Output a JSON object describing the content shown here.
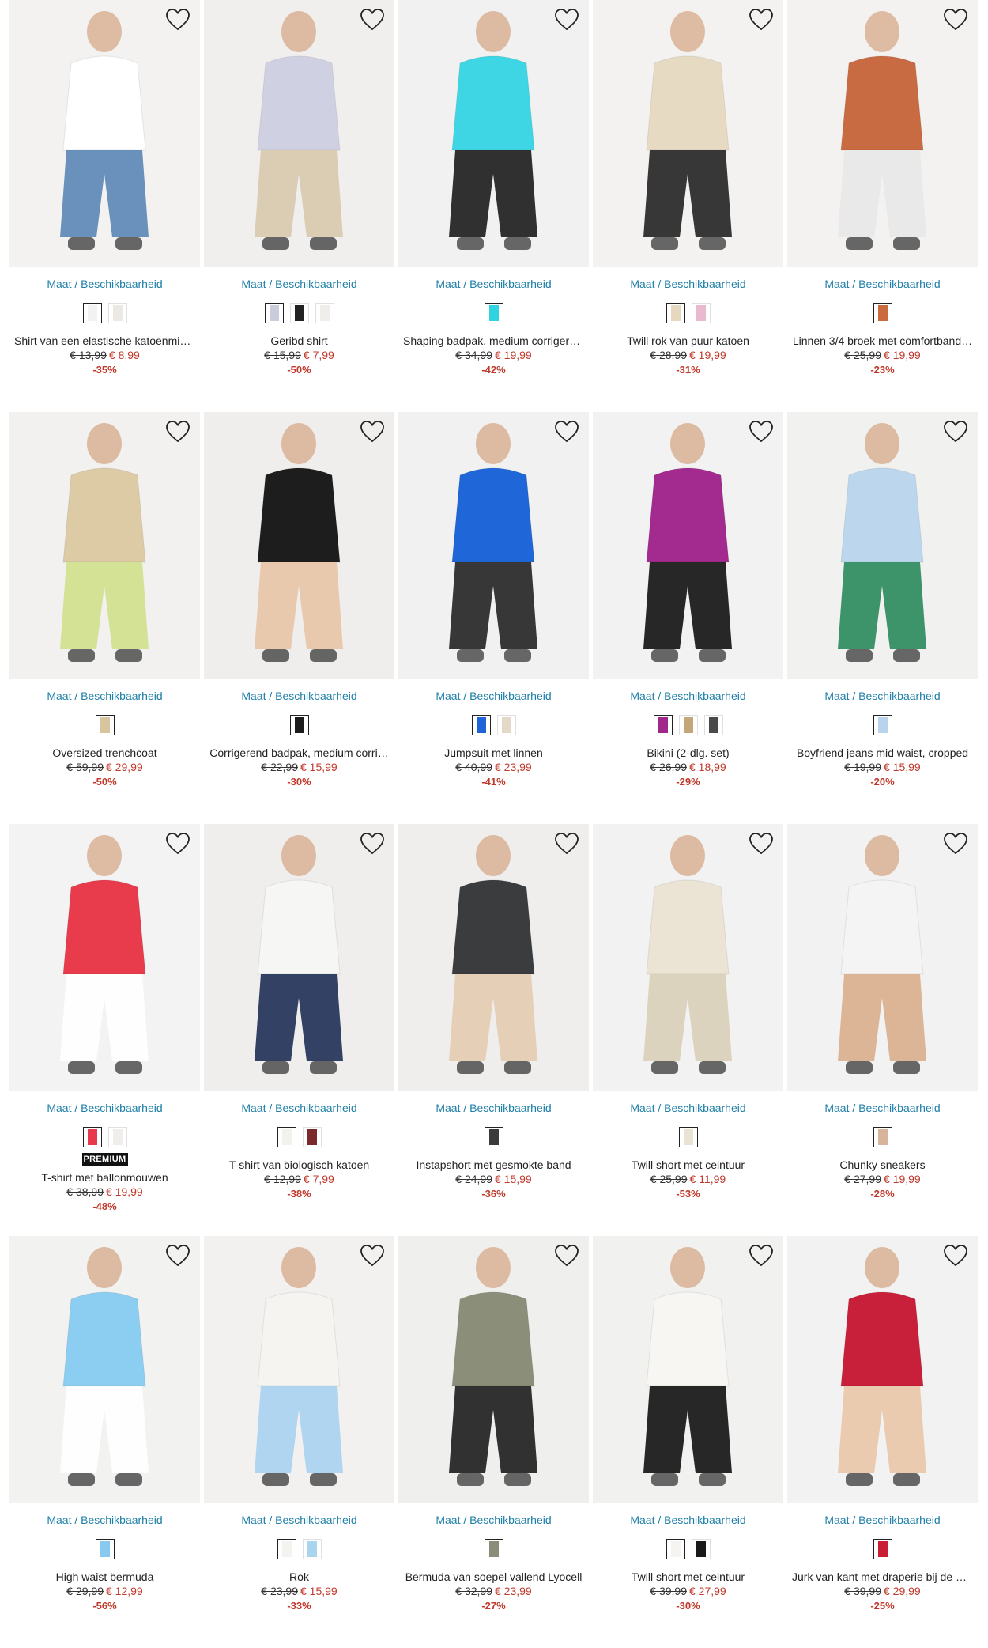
{
  "availability_label": "Maat / Beschikbaarheid",
  "premium_label": "PREMIUM",
  "products": [
    {
      "title": "Shirt van een elastische katoenmix …",
      "old": "€ 13,99",
      "new": "€ 8,99",
      "disc": "-35%",
      "swatches": [
        "#f2f2f2",
        "#ece9e4"
      ],
      "bg": "#f3f2f0",
      "garment": "#ffffff",
      "accent": "#5b86b5"
    },
    {
      "title": "Geribd shirt",
      "old": "€ 15,99",
      "new": "€ 7,99",
      "disc": "-50%",
      "swatches": [
        "#c9ccdb",
        "#222222",
        "#efeeea"
      ],
      "bg": "#f0efee",
      "garment": "#cfd1e2",
      "accent": "#d8c9ad"
    },
    {
      "title": "Shaping badpak, medium corrigerend",
      "old": "€ 34,99",
      "new": "€ 19,99",
      "disc": "-42%",
      "swatches": [
        "#2fd4e0"
      ],
      "bg": "#f1f1f1",
      "garment": "#3ed6e4",
      "accent": "#1b1b1b"
    },
    {
      "title": "Twill rok van puur katoen",
      "old": "€ 28,99",
      "new": "€ 19,99",
      "disc": "-31%",
      "swatches": [
        "#e5d8bf",
        "#e8b9cf"
      ],
      "bg": "#f3f2f0",
      "garment": "#e6dac3",
      "accent": "#222222"
    },
    {
      "title": "Linnen 3/4 broek met comfortband…",
      "old": "€ 25,99",
      "new": "€ 19,99",
      "disc": "-23%",
      "swatches": [
        "#c96a3f"
      ],
      "bg": "#f3f2f0",
      "garment": "#c96b42",
      "accent": "#e8e8e8"
    },
    {
      "title": "Oversized trenchcoat",
      "old": "€ 59,99",
      "new": "€ 29,99",
      "disc": "-50%",
      "swatches": [
        "#d8c49d"
      ],
      "bg": "#f2f1ef",
      "garment": "#dccba4",
      "accent": "#cfe08a"
    },
    {
      "title": "Corrigerend badpak, medium corri…",
      "old": "€ 22,99",
      "new": "€ 15,99",
      "disc": "-30%",
      "swatches": [
        "#1c1c1c"
      ],
      "bg": "#efeeec",
      "garment": "#1d1d1d",
      "accent": "#e8c4a6"
    },
    {
      "title": "Jumpsuit met linnen",
      "old": "€ 40,99",
      "new": "€ 23,99",
      "disc": "-41%",
      "swatches": [
        "#1f63d6",
        "#e3d9c6"
      ],
      "bg": "#f1f1f1",
      "garment": "#1f66d8",
      "accent": "#222222"
    },
    {
      "title": "Bikini (2-dlg. set)",
      "old": "€ 26,99",
      "new": "€ 18,99",
      "disc": "-29%",
      "swatches": [
        "#a0288a",
        "#c3a77a",
        "#4a4a4a"
      ],
      "bg": "#f2f2f2",
      "garment": "#a32a8f",
      "accent": "#111111"
    },
    {
      "title": "Boyfriend jeans mid waist, cropped",
      "old": "€ 19,99",
      "new": "€ 15,99",
      "disc": "-20%",
      "swatches": [
        "#b9d3ec"
      ],
      "bg": "#f1f1f0",
      "garment": "#bcd6ee",
      "accent": "#2a8a5b"
    },
    {
      "title": "T-shirt met ballonmouwen",
      "old": "€ 38,99",
      "new": "€ 19,99",
      "disc": "-48%",
      "swatches": [
        "#e8394a",
        "#f0eeea"
      ],
      "premium": true,
      "bg": "#f3f3f3",
      "garment": "#e83c4c",
      "accent": "#ffffff"
    },
    {
      "title": "T-shirt van biologisch katoen",
      "old": "€ 12,99",
      "new": "€ 7,99",
      "disc": "-38%",
      "swatches": [
        "#f3f1ec",
        "#7a2a2a"
      ],
      "bg": "#efeeed",
      "garment": "#f6f6f4",
      "accent": "#1e2d55"
    },
    {
      "title": "Instapshort met gesmokte band",
      "old": "€ 24,99",
      "new": "€ 15,99",
      "disc": "-36%",
      "swatches": [
        "#3a3a3a"
      ],
      "bg": "#efeeed",
      "garment": "#3b3c3d",
      "accent": "#e3ccb0"
    },
    {
      "title": "Twill short met ceintuur",
      "old": "€ 25,99",
      "new": "€ 11,99",
      "disc": "-53%",
      "swatches": [
        "#e9e3d3"
      ],
      "bg": "#f2f2f2",
      "garment": "#ebe4d4",
      "accent": "#d9cfb8"
    },
    {
      "title": "Chunky sneakers",
      "old": "€ 27,99",
      "new": "€ 19,99",
      "disc": "-28%",
      "swatches": [
        "#d8b59a"
      ],
      "bg": "#f2f2f2",
      "garment": "#f4f4f4",
      "accent": "#d9ae8c"
    },
    {
      "title": "High waist bermuda",
      "old": "€ 29,99",
      "new": "€ 12,99",
      "disc": "-56%",
      "swatches": [
        "#87c9f0"
      ],
      "bg": "#f2f2f1",
      "garment": "#8ccdf2",
      "accent": "#ffffff"
    },
    {
      "title": "Rok",
      "old": "€ 23,99",
      "new": "€ 15,99",
      "disc": "-33%",
      "swatches": [
        "#f4f3ef",
        "#a9d4ee"
      ],
      "bg": "#f2f1f0",
      "garment": "#f5f4f0",
      "accent": "#a8d2ef"
    },
    {
      "title": "Bermuda van soepel vallend Lyocell",
      "old": "€ 32,99",
      "new": "€ 23,99",
      "disc": "-27%",
      "swatches": [
        "#8a8e78"
      ],
      "bg": "#efefed",
      "garment": "#8b8f79",
      "accent": "#1c1c1c"
    },
    {
      "title": "Twill short met ceintuur",
      "old": "€ 39,99",
      "new": "€ 27,99",
      "disc": "-30%",
      "swatches": [
        "#f5f4f0",
        "#1a1a1a"
      ],
      "bg": "#f1f1f0",
      "garment": "#f7f6f2",
      "accent": "#111111"
    },
    {
      "title": "Jurk van kant met draperie bij de m…",
      "old": "€ 39,99",
      "new": "€ 29,99",
      "disc": "-25%",
      "swatches": [
        "#c81f34"
      ],
      "bg": "#f2f2f2",
      "garment": "#c8203a",
      "accent": "#e9c7a9"
    }
  ]
}
